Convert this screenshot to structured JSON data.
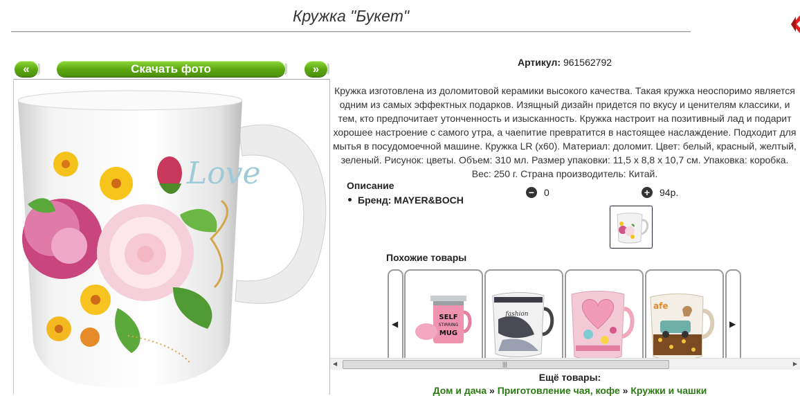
{
  "page": {
    "title": "Кружка \"Букет\""
  },
  "gallery": {
    "prev_label": "«",
    "download_label": "Скачать фото",
    "next_label": "»"
  },
  "product": {
    "sku_label": "Артикул:",
    "sku_value": "961562792",
    "description": "Кружка изготовлена из доломитовой керамики высокого качества. Такая кружка неоспоримо является одним из самых эффектных подарков. Изящный дизайн придется по вкусу и ценителям классики, и тем, кто предпочитает утонченность и изысканность. Кружка настроит на позитивный лад и подарит хорошее настроение с самого утра, а чаепитие превратится в настоящее наслаждение. Подходит для мытья в посудомоечной машине. Кружка LR (x60). Материал: доломит. Цвет: белый, красный, желтый, зеленый. Рисунок: цветы. Объем: 310 мл. Размер упаковки: 11,5 х 8,8 х 10,7 см. Упаковка: коробка. Вес: 250 г. Страна производитель: Китай.",
    "desc_heading": "Описание",
    "brand_line": "Бренд: MAYER&BOCH",
    "quantity": "0",
    "price": "94р.",
    "minus_symbol": "−",
    "plus_symbol": "+"
  },
  "similar": {
    "heading": "Похожие товары",
    "left_arrow": "◀",
    "right_arrow": "▶",
    "scroll_left": "◀",
    "scroll_right": "▶",
    "scroll_grip": "|||",
    "items": [
      {
        "caption": "SELF STIRRING MUG"
      },
      {
        "caption": "fashion"
      },
      {
        "caption": "hearts"
      },
      {
        "caption": "cafe"
      }
    ]
  },
  "more": {
    "heading": "Ещё товары:",
    "crumbs": [
      "Дом и дача",
      "Приготовление чая, кофе",
      "Кружки и чашки"
    ],
    "separator": "»"
  },
  "colors": {
    "button_green": "#5aa60f",
    "link_green": "#2a7a12",
    "close_red": "#d22"
  }
}
